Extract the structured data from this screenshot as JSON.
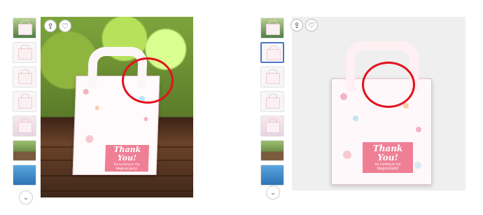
{
  "left_panel": {
    "thumbnails": [
      "box thumbnail",
      "box thumbnail",
      "box thumbnail",
      "box thumbnail",
      "box thumbnail",
      "garden thumbnail",
      "pool thumbnail"
    ],
    "label_title": "Thank You!",
    "label_message": "for coming to my\nMagical party!"
  },
  "right_panel": {
    "thumbnails": [
      "garden thumbnail",
      "box thumbnail",
      "box thumbnail",
      "box thumbnail",
      "box thumbnail",
      "garden thumbnail",
      "pool thumbnail"
    ],
    "label_title": "Thank You!",
    "label_message": "for coming to my\nMagical party!"
  },
  "icons": {
    "share": "share-icon",
    "favorite": "heart-icon",
    "more": "chevron-down-icon"
  },
  "accent": {
    "pink": "#ef7f95",
    "circle": "#e3111d",
    "selected_border": "#4a78c4"
  }
}
